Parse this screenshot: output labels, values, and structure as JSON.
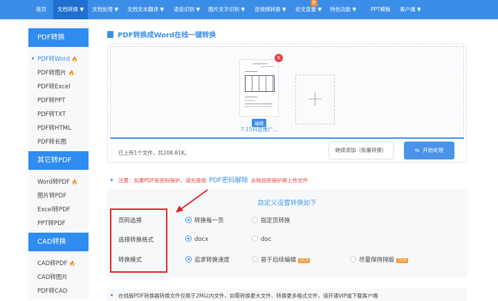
{
  "nav": {
    "items": [
      "首页",
      "文档转换 ▼",
      "文档处理 ▼",
      "文档文本翻译 ▼",
      "语音识别 ▼",
      "图片文字识别 ▼",
      "音视频转换 ▼",
      "论文查重 ▼",
      "特色功能 ▼",
      "PPT模板",
      "客户端 ▼"
    ],
    "new_badge": "新"
  },
  "sidebar": {
    "sections": [
      {
        "title": "PDF转换",
        "items": [
          "PDF转Word",
          "PDF转图片",
          "PDF转Excel",
          "PDF转PPT",
          "PDF转TXT",
          "PDF转HTML",
          "PDF转长图"
        ]
      },
      {
        "title": "其它转PDF",
        "items": [
          "Word转PDF",
          "图片转PDF",
          "Excel转PDF",
          "PPT转PDF"
        ]
      },
      {
        "title": "CAD转换",
        "items": [
          "CAD转PDF",
          "CAD转图片",
          "PDF转CAD"
        ]
      }
    ],
    "hot": "🔥"
  },
  "main": {
    "title": "PDF转换成Word在线一键转换",
    "upload": {
      "file_name": "7.15抖音推广...",
      "edit_label": "编辑",
      "add_icon": "+",
      "close_icon": "×",
      "info": "已上传1个文件，共208.81K。",
      "continue_label": "继续添加（批量转换）",
      "start_label": "开始处理",
      "start_icon": "⇆"
    },
    "note": {
      "prefix": "注意：如果PDF有密码保护，请先使用",
      "link": "PDF密码解除",
      "suffix": "去除加密保护再上传文件"
    },
    "settings": {
      "title": "自定义设置转换如下",
      "rows": [
        {
          "label": "页码选择",
          "options": [
            "转换每一页",
            "指定页转换"
          ]
        },
        {
          "label": "选择转换格式",
          "options": [
            "docx",
            "doc"
          ]
        },
        {
          "label": "转换模式",
          "options": [
            "追求转换速度",
            "易于后续编辑",
            "尽量保持排版"
          ]
        }
      ],
      "ocr": "OCR"
    },
    "footer_note": "在线版PDF转换器转换文件仅限于2M以内文件，如需转换更大文件、转换更多格式文件，请开通VIP或下载客户端"
  }
}
